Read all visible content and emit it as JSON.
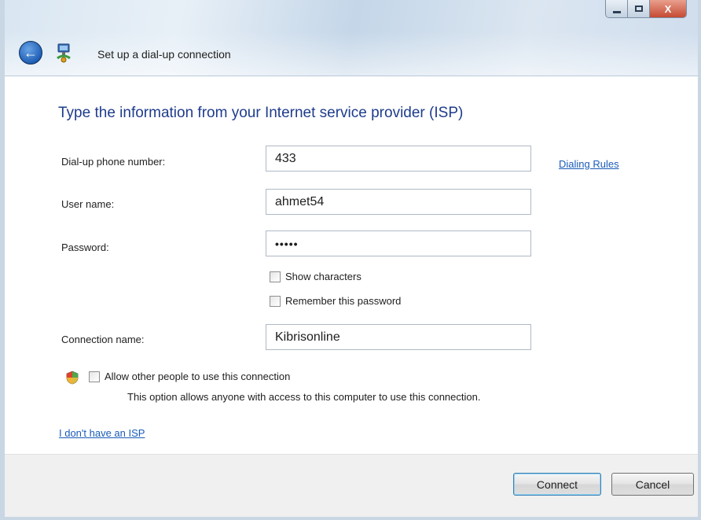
{
  "window": {
    "title": "Set up a dial-up connection",
    "caption": {
      "minimize": "",
      "maximize": "",
      "close": "X"
    }
  },
  "form": {
    "heading": "Type the information from your Internet service provider (ISP)",
    "phone": {
      "label": "Dial-up phone number:",
      "value": "433"
    },
    "username": {
      "label": "User name:",
      "value": "ahmet54"
    },
    "password": {
      "label": "Password:",
      "value": "•••••"
    },
    "show_characters": {
      "label": "Show characters",
      "checked": false
    },
    "remember_password": {
      "label": "Remember this password",
      "checked": false
    },
    "connection_name": {
      "label": "Connection name:",
      "value": "Kibrisonline"
    },
    "allow_others": {
      "label": "Allow other people to use this connection",
      "checked": false,
      "note": "This option allows anyone with access to this computer to use this connection."
    },
    "dialing_rules_link": "Dialing Rules",
    "no_isp_link": "I don't have an ISP"
  },
  "footer": {
    "connect": "Connect",
    "cancel": "Cancel"
  }
}
